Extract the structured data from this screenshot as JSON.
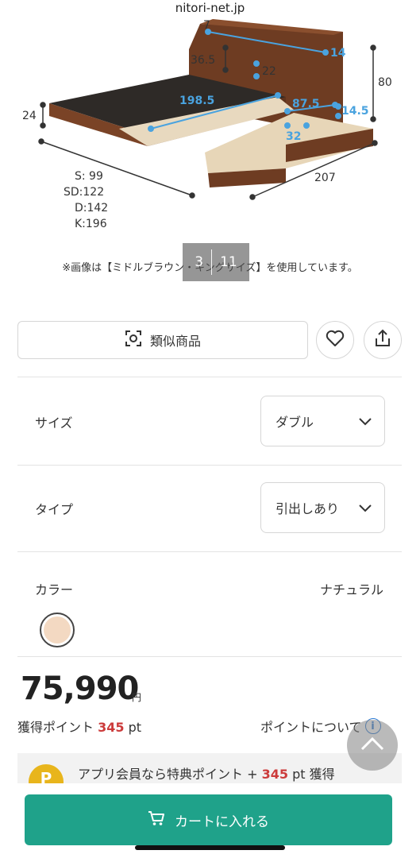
{
  "browser": {
    "url": "nitori-net.jp"
  },
  "gallery": {
    "dimensions": [
      "7",
      "14",
      "36.5",
      "22",
      "80",
      "24",
      "198.5",
      "87.5",
      "14.5",
      "32",
      "207"
    ],
    "sizes": [
      "S:  99",
      "SD:122",
      "D:142",
      "K:196"
    ],
    "current": "3",
    "total": "11",
    "caption": "※画像は【ミドルブラウン・キングサイズ】を使用しています。"
  },
  "actions": {
    "similar_label": "類似商品"
  },
  "options": {
    "size_label": "サイズ",
    "size_value": "ダブル",
    "type_label": "タイプ",
    "type_value": "引出しあり",
    "color_label": "カラー",
    "color_value": "ナチュラル",
    "color_swatch": "#f3d9c2"
  },
  "price": {
    "amount": "75,990",
    "currency": "円"
  },
  "points": {
    "label": "獲得ポイント",
    "value": "345",
    "unit": "pt",
    "about_label": "ポイントについて"
  },
  "app_banner": {
    "coin": "P",
    "text_before": "アプリ会員なら特典ポイント + ",
    "value": "345",
    "text_after": " pt 獲得"
  },
  "cart": {
    "label": "カートに入れる"
  },
  "colors": {
    "accent": "#1fa28a",
    "point": "#cc3b3b",
    "info": "#2d7bd4",
    "dimension": "#4aa3df"
  }
}
